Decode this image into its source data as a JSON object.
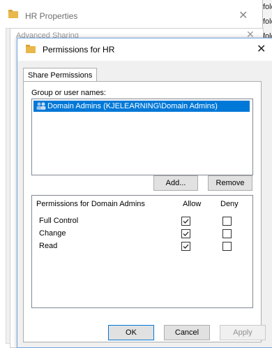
{
  "hr_window": {
    "title": "HR Properties",
    "close": "✕"
  },
  "peek": [
    "folde",
    "folde",
    "folde"
  ],
  "advanced": {
    "title": "Advanced Sharing",
    "close": "✕"
  },
  "perm": {
    "title": "Permissions for HR",
    "close": "✕",
    "tab": "Share Permissions",
    "group_label": "Group or user names:",
    "group_item": "Domain Admins (KJELEARNING\\Domain Admins)",
    "add": "Add...",
    "remove": "Remove",
    "table_header": {
      "name": "Permissions for Domain Admins",
      "allow": "Allow",
      "deny": "Deny"
    },
    "rows": [
      {
        "name": "Full Control",
        "allow": true,
        "deny": false
      },
      {
        "name": "Change",
        "allow": true,
        "deny": false
      },
      {
        "name": "Read",
        "allow": true,
        "deny": false
      }
    ],
    "ok": "OK",
    "cancel": "Cancel",
    "apply": "Apply"
  },
  "colors": {
    "accent": "#0078d7",
    "folder": "#e8b84a"
  },
  "icons": [
    "folder-icon",
    "close-icon",
    "users-icon",
    "checkbox-icon"
  ]
}
